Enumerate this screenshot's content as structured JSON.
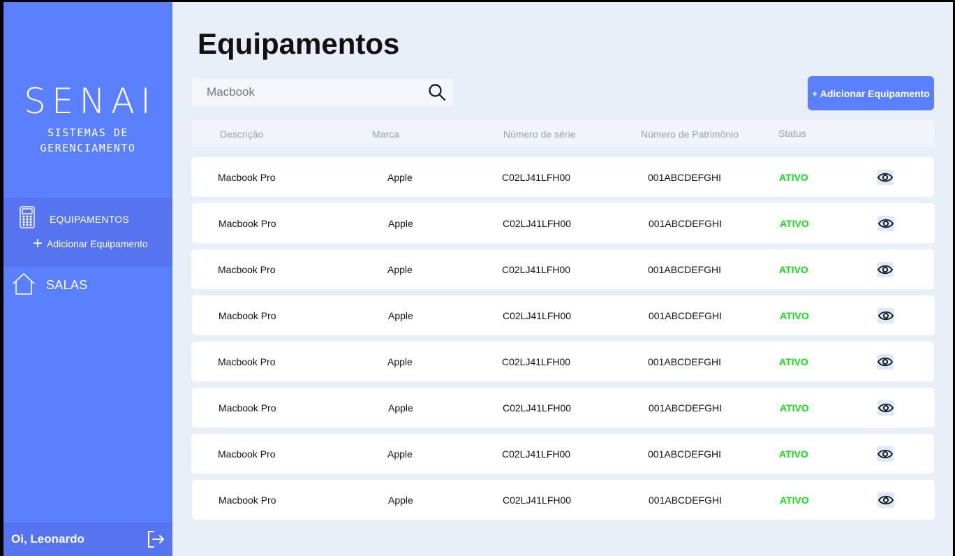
{
  "sidebar": {
    "logo_main": "SENAI",
    "logo_sub_1": "SISTEMAS DE",
    "logo_sub_2": "GERENCIAMENTO",
    "nav_equipamentos": "EQUIPAMENTOS",
    "nav_add_equipamento": "Adicionar Equipamento",
    "nav_salas": "SALAS",
    "user_greeting": "Oi, Leonardo"
  },
  "main": {
    "title": "Equipamentos",
    "search": {
      "value": "",
      "placeholder": "Macbook"
    },
    "add_button": "+ Adicionar Equipamento",
    "columns": [
      "Descrição",
      "Marca",
      "Número de série",
      "Número de Patrimônio",
      "Status"
    ],
    "rows": [
      {
        "descricao": "Macbook Pro",
        "marca": "Apple",
        "serie": "C02LJ41LFH00",
        "patrimonio": "001ABCDEFGHI",
        "status": "ATIVO"
      },
      {
        "descricao": "Macbook Pro",
        "marca": "Apple",
        "serie": "C02LJ41LFH00",
        "patrimonio": "001ABCDEFGHI",
        "status": "ATIVO"
      },
      {
        "descricao": "Macbook Pro",
        "marca": "Apple",
        "serie": "C02LJ41LFH00",
        "patrimonio": "001ABCDEFGHI",
        "status": "ATIVO"
      },
      {
        "descricao": "Macbook Pro",
        "marca": "Apple",
        "serie": "C02LJ41LFH00",
        "patrimonio": "001ABCDEFGHI",
        "status": "ATIVO"
      },
      {
        "descricao": "Macbook Pro",
        "marca": "Apple",
        "serie": "C02LJ41LFH00",
        "patrimonio": "001ABCDEFGHI",
        "status": "ATIVO"
      },
      {
        "descricao": "Macbook Pro",
        "marca": "Apple",
        "serie": "C02LJ41LFH00",
        "patrimonio": "001ABCDEFGHI",
        "status": "ATIVO"
      },
      {
        "descricao": "Macbook Pro",
        "marca": "Apple",
        "serie": "C02LJ41LFH00",
        "patrimonio": "001ABCDEFGHI",
        "status": "ATIVO"
      },
      {
        "descricao": "Macbook Pro",
        "marca": "Apple",
        "serie": "C02LJ41LFH00",
        "patrimonio": "001ABCDEFGHI",
        "status": "ATIVO"
      }
    ],
    "status_color": "#12e01a",
    "row_action_icon": "eye-icon"
  },
  "colors": {
    "sidebar": "#5a7fff",
    "sidebar_active": "#5674ef",
    "background": "#e8eff9",
    "accent": "#5a7fff"
  }
}
